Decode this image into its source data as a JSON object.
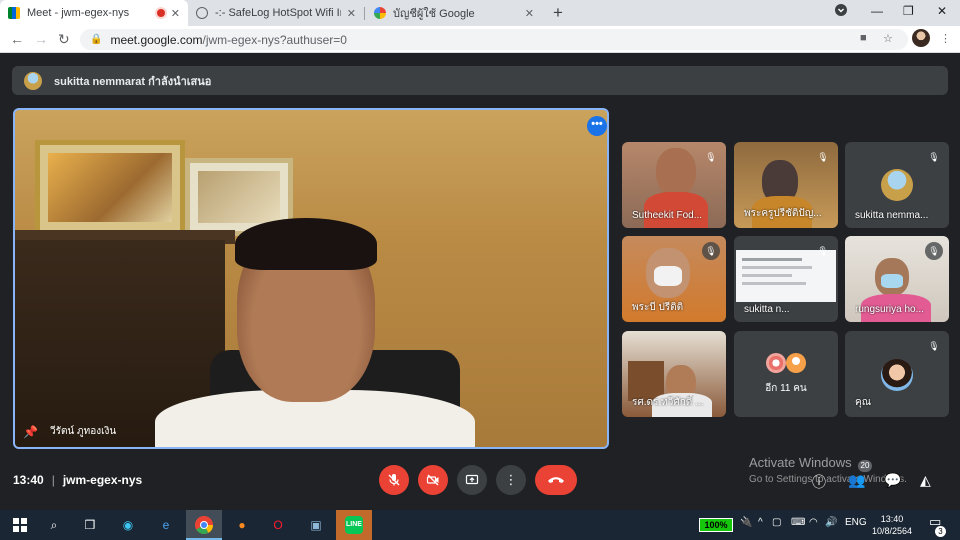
{
  "browser": {
    "tabs": [
      {
        "title": "Meet - jwm-egex-nys",
        "icon": "meet-icon",
        "recording": true,
        "active": true
      },
      {
        "title": "-:- SafeLog HotSpot Wifi Internet",
        "icon": "globe-icon",
        "active": false
      },
      {
        "title": "บัญชีผู้ใช้ Google",
        "icon": "google-icon",
        "active": false
      }
    ],
    "close_glyph": "✕",
    "new_tab_glyph": "+",
    "url_host": "meet.google.com",
    "url_path": "/jwm-egex-nys?authuser=0"
  },
  "meet": {
    "presenting_banner": "sukitta nemmarat กำลังนำเสนอ",
    "main_participant": "วีรัตน์ ภูทองเงิน",
    "participants": [
      {
        "name": "Sutheekit Fod...",
        "muted": true
      },
      {
        "name": "พระครูปรีชัติปัญ...",
        "muted": true
      },
      {
        "name": "sukitta nemma...",
        "muted": true
      },
      {
        "name": "พระบี ปรีติติ",
        "muted": true
      },
      {
        "name": "sukitta n...",
        "muted": true
      },
      {
        "name": "rungsuriya ho...",
        "muted": true
      },
      {
        "name": "รศ.ดร.ทวีศักดิ์ ...",
        "muted": false
      },
      {
        "name": "อีก 11 คน",
        "muted": false
      },
      {
        "name": "คุณ",
        "muted": true
      }
    ],
    "meeting_time": "13:40",
    "meeting_code": "jwm-egex-nys",
    "participant_count": "20"
  },
  "overlay": {
    "activate_title": "Activate Windows",
    "activate_sub": "Go to Settings to activate Windows."
  },
  "taskbar": {
    "battery": "100%",
    "language": "ENG",
    "time": "13:40",
    "date": "10/8/2564",
    "notifications": "3"
  },
  "colors": {
    "meet_bg": "#202124",
    "danger": "#ea4335",
    "accent": "#1a73e8",
    "tile_bg": "#3c4043"
  }
}
